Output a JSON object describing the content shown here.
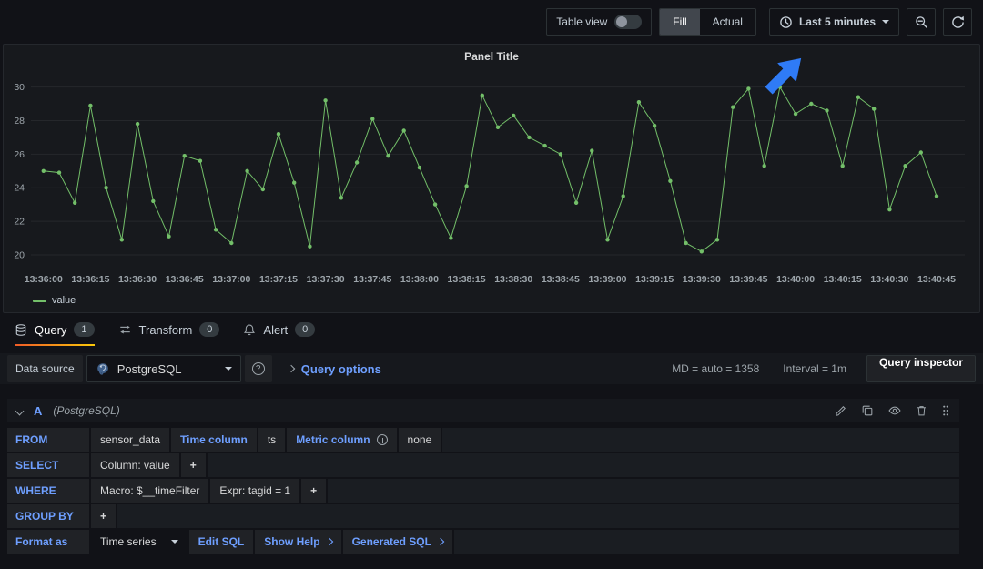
{
  "topbar": {
    "table_view_label": "Table view",
    "fill_label": "Fill",
    "actual_label": "Actual",
    "time_range_label": "Last 5 minutes"
  },
  "panel": {
    "title": "Panel Title",
    "legend_label": "value"
  },
  "tabs": [
    {
      "label": "Query",
      "count": "1"
    },
    {
      "label": "Transform",
      "count": "0"
    },
    {
      "label": "Alert",
      "count": "0"
    }
  ],
  "datasource_bar": {
    "label": "Data source",
    "value": "PostgreSQL",
    "help_glyph": "?",
    "query_options_label": "Query options",
    "md_info": "MD = auto = 1358",
    "interval_info": "Interval = 1m",
    "query_inspector_label": "Query inspector"
  },
  "query": {
    "ref_id": "A",
    "ds_hint": "(PostgreSQL)",
    "rows": {
      "from": {
        "label": "FROM",
        "table": "sensor_data",
        "time_column_label": "Time column",
        "time_column_value": "ts",
        "metric_column_label": "Metric column",
        "metric_column_value": "none"
      },
      "select": {
        "label": "SELECT",
        "column": "Column: value",
        "add": "+"
      },
      "where": {
        "label": "WHERE",
        "macro": "Macro: $__timeFilter",
        "expr": "Expr: tagid = 1",
        "add": "+"
      },
      "groupby": {
        "label": "GROUP BY",
        "add": "+"
      },
      "format": {
        "label": "Format as",
        "value": "Time series",
        "edit_sql": "Edit SQL",
        "show_help": "Show Help",
        "generated_sql": "Generated SQL"
      }
    }
  },
  "colors": {
    "series_green": "#73bf69",
    "link_blue": "#6e9fff",
    "tab_underline_orange": "#f05a28",
    "cursor_blue": "#2f7bf6"
  },
  "chart_data": {
    "type": "line",
    "title": "Panel Title",
    "xlabel": "",
    "ylabel": "",
    "legend_position": "bottom-left",
    "grid": "horizontal",
    "x_start": "13:36:00",
    "x_step_seconds": 5,
    "x_tick_step_seconds": 15,
    "x_tick_labels": [
      "13:36:00",
      "13:36:15",
      "13:36:30",
      "13:36:45",
      "13:37:00",
      "13:37:15",
      "13:37:30",
      "13:37:45",
      "13:38:00",
      "13:38:15",
      "13:38:30",
      "13:38:45",
      "13:39:00",
      "13:39:15",
      "13:39:30",
      "13:39:45",
      "13:40:00",
      "13:40:15",
      "13:40:30",
      "13:40:45"
    ],
    "xlim_seconds": [
      -4,
      294
    ],
    "ylim": [
      19.4,
      30.9
    ],
    "yticks": [
      20,
      22,
      24,
      26,
      28,
      30
    ],
    "color": "#73bf69",
    "series": [
      {
        "name": "value",
        "values": [
          25.0,
          24.9,
          23.1,
          28.9,
          24.0,
          20.9,
          27.8,
          23.2,
          21.1,
          25.9,
          25.6,
          21.5,
          20.7,
          25.0,
          23.9,
          27.2,
          24.3,
          20.5,
          29.2,
          23.4,
          25.5,
          28.1,
          25.9,
          27.4,
          25.2,
          23.0,
          21.0,
          24.1,
          29.5,
          27.6,
          28.3,
          27.0,
          26.5,
          26.0,
          23.1,
          26.2,
          20.9,
          23.5,
          29.1,
          27.7,
          24.4,
          20.7,
          20.2,
          20.9,
          28.8,
          29.9,
          25.3,
          30.0,
          28.4,
          29.0,
          28.6,
          25.3,
          29.4,
          28.7,
          22.7,
          25.3,
          26.1,
          23.5
        ]
      }
    ]
  }
}
